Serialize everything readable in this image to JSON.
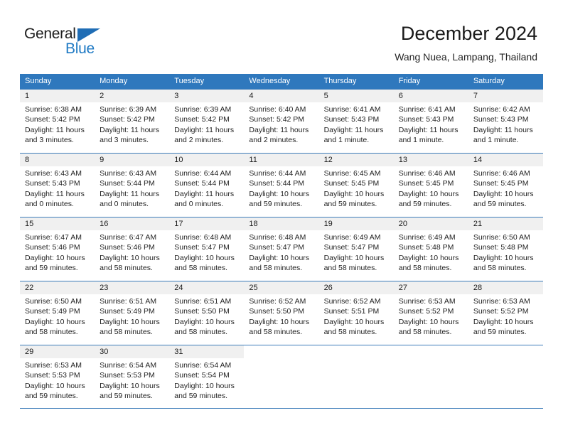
{
  "brand": {
    "name_part1": "General",
    "name_part2": "Blue",
    "triangle_icon": "triangle-icon",
    "colors": {
      "dark": "#1d1d1d",
      "blue": "#1f7ac4",
      "header_blue": "#2f78bd",
      "day_band": "#f0f0f0"
    }
  },
  "header": {
    "title": "December 2024",
    "location": "Wang Nuea, Lampang, Thailand"
  },
  "calendar": {
    "weekdays": [
      "Sunday",
      "Monday",
      "Tuesday",
      "Wednesday",
      "Thursday",
      "Friday",
      "Saturday"
    ],
    "weeks": [
      [
        {
          "day": "1",
          "sunrise": "Sunrise: 6:38 AM",
          "sunset": "Sunset: 5:42 PM",
          "daylight": "Daylight: 11 hours and 3 minutes."
        },
        {
          "day": "2",
          "sunrise": "Sunrise: 6:39 AM",
          "sunset": "Sunset: 5:42 PM",
          "daylight": "Daylight: 11 hours and 3 minutes."
        },
        {
          "day": "3",
          "sunrise": "Sunrise: 6:39 AM",
          "sunset": "Sunset: 5:42 PM",
          "daylight": "Daylight: 11 hours and 2 minutes."
        },
        {
          "day": "4",
          "sunrise": "Sunrise: 6:40 AM",
          "sunset": "Sunset: 5:42 PM",
          "daylight": "Daylight: 11 hours and 2 minutes."
        },
        {
          "day": "5",
          "sunrise": "Sunrise: 6:41 AM",
          "sunset": "Sunset: 5:43 PM",
          "daylight": "Daylight: 11 hours and 1 minute."
        },
        {
          "day": "6",
          "sunrise": "Sunrise: 6:41 AM",
          "sunset": "Sunset: 5:43 PM",
          "daylight": "Daylight: 11 hours and 1 minute."
        },
        {
          "day": "7",
          "sunrise": "Sunrise: 6:42 AM",
          "sunset": "Sunset: 5:43 PM",
          "daylight": "Daylight: 11 hours and 1 minute."
        }
      ],
      [
        {
          "day": "8",
          "sunrise": "Sunrise: 6:43 AM",
          "sunset": "Sunset: 5:43 PM",
          "daylight": "Daylight: 11 hours and 0 minutes."
        },
        {
          "day": "9",
          "sunrise": "Sunrise: 6:43 AM",
          "sunset": "Sunset: 5:44 PM",
          "daylight": "Daylight: 11 hours and 0 minutes."
        },
        {
          "day": "10",
          "sunrise": "Sunrise: 6:44 AM",
          "sunset": "Sunset: 5:44 PM",
          "daylight": "Daylight: 11 hours and 0 minutes."
        },
        {
          "day": "11",
          "sunrise": "Sunrise: 6:44 AM",
          "sunset": "Sunset: 5:44 PM",
          "daylight": "Daylight: 10 hours and 59 minutes."
        },
        {
          "day": "12",
          "sunrise": "Sunrise: 6:45 AM",
          "sunset": "Sunset: 5:45 PM",
          "daylight": "Daylight: 10 hours and 59 minutes."
        },
        {
          "day": "13",
          "sunrise": "Sunrise: 6:46 AM",
          "sunset": "Sunset: 5:45 PM",
          "daylight": "Daylight: 10 hours and 59 minutes."
        },
        {
          "day": "14",
          "sunrise": "Sunrise: 6:46 AM",
          "sunset": "Sunset: 5:45 PM",
          "daylight": "Daylight: 10 hours and 59 minutes."
        }
      ],
      [
        {
          "day": "15",
          "sunrise": "Sunrise: 6:47 AM",
          "sunset": "Sunset: 5:46 PM",
          "daylight": "Daylight: 10 hours and 59 minutes."
        },
        {
          "day": "16",
          "sunrise": "Sunrise: 6:47 AM",
          "sunset": "Sunset: 5:46 PM",
          "daylight": "Daylight: 10 hours and 58 minutes."
        },
        {
          "day": "17",
          "sunrise": "Sunrise: 6:48 AM",
          "sunset": "Sunset: 5:47 PM",
          "daylight": "Daylight: 10 hours and 58 minutes."
        },
        {
          "day": "18",
          "sunrise": "Sunrise: 6:48 AM",
          "sunset": "Sunset: 5:47 PM",
          "daylight": "Daylight: 10 hours and 58 minutes."
        },
        {
          "day": "19",
          "sunrise": "Sunrise: 6:49 AM",
          "sunset": "Sunset: 5:47 PM",
          "daylight": "Daylight: 10 hours and 58 minutes."
        },
        {
          "day": "20",
          "sunrise": "Sunrise: 6:49 AM",
          "sunset": "Sunset: 5:48 PM",
          "daylight": "Daylight: 10 hours and 58 minutes."
        },
        {
          "day": "21",
          "sunrise": "Sunrise: 6:50 AM",
          "sunset": "Sunset: 5:48 PM",
          "daylight": "Daylight: 10 hours and 58 minutes."
        }
      ],
      [
        {
          "day": "22",
          "sunrise": "Sunrise: 6:50 AM",
          "sunset": "Sunset: 5:49 PM",
          "daylight": "Daylight: 10 hours and 58 minutes."
        },
        {
          "day": "23",
          "sunrise": "Sunrise: 6:51 AM",
          "sunset": "Sunset: 5:49 PM",
          "daylight": "Daylight: 10 hours and 58 minutes."
        },
        {
          "day": "24",
          "sunrise": "Sunrise: 6:51 AM",
          "sunset": "Sunset: 5:50 PM",
          "daylight": "Daylight: 10 hours and 58 minutes."
        },
        {
          "day": "25",
          "sunrise": "Sunrise: 6:52 AM",
          "sunset": "Sunset: 5:50 PM",
          "daylight": "Daylight: 10 hours and 58 minutes."
        },
        {
          "day": "26",
          "sunrise": "Sunrise: 6:52 AM",
          "sunset": "Sunset: 5:51 PM",
          "daylight": "Daylight: 10 hours and 58 minutes."
        },
        {
          "day": "27",
          "sunrise": "Sunrise: 6:53 AM",
          "sunset": "Sunset: 5:52 PM",
          "daylight": "Daylight: 10 hours and 58 minutes."
        },
        {
          "day": "28",
          "sunrise": "Sunrise: 6:53 AM",
          "sunset": "Sunset: 5:52 PM",
          "daylight": "Daylight: 10 hours and 59 minutes."
        }
      ],
      [
        {
          "day": "29",
          "sunrise": "Sunrise: 6:53 AM",
          "sunset": "Sunset: 5:53 PM",
          "daylight": "Daylight: 10 hours and 59 minutes."
        },
        {
          "day": "30",
          "sunrise": "Sunrise: 6:54 AM",
          "sunset": "Sunset: 5:53 PM",
          "daylight": "Daylight: 10 hours and 59 minutes."
        },
        {
          "day": "31",
          "sunrise": "Sunrise: 6:54 AM",
          "sunset": "Sunset: 5:54 PM",
          "daylight": "Daylight: 10 hours and 59 minutes."
        },
        {
          "day": "",
          "sunrise": "",
          "sunset": "",
          "daylight": ""
        },
        {
          "day": "",
          "sunrise": "",
          "sunset": "",
          "daylight": ""
        },
        {
          "day": "",
          "sunrise": "",
          "sunset": "",
          "daylight": ""
        },
        {
          "day": "",
          "sunrise": "",
          "sunset": "",
          "daylight": ""
        }
      ]
    ]
  }
}
